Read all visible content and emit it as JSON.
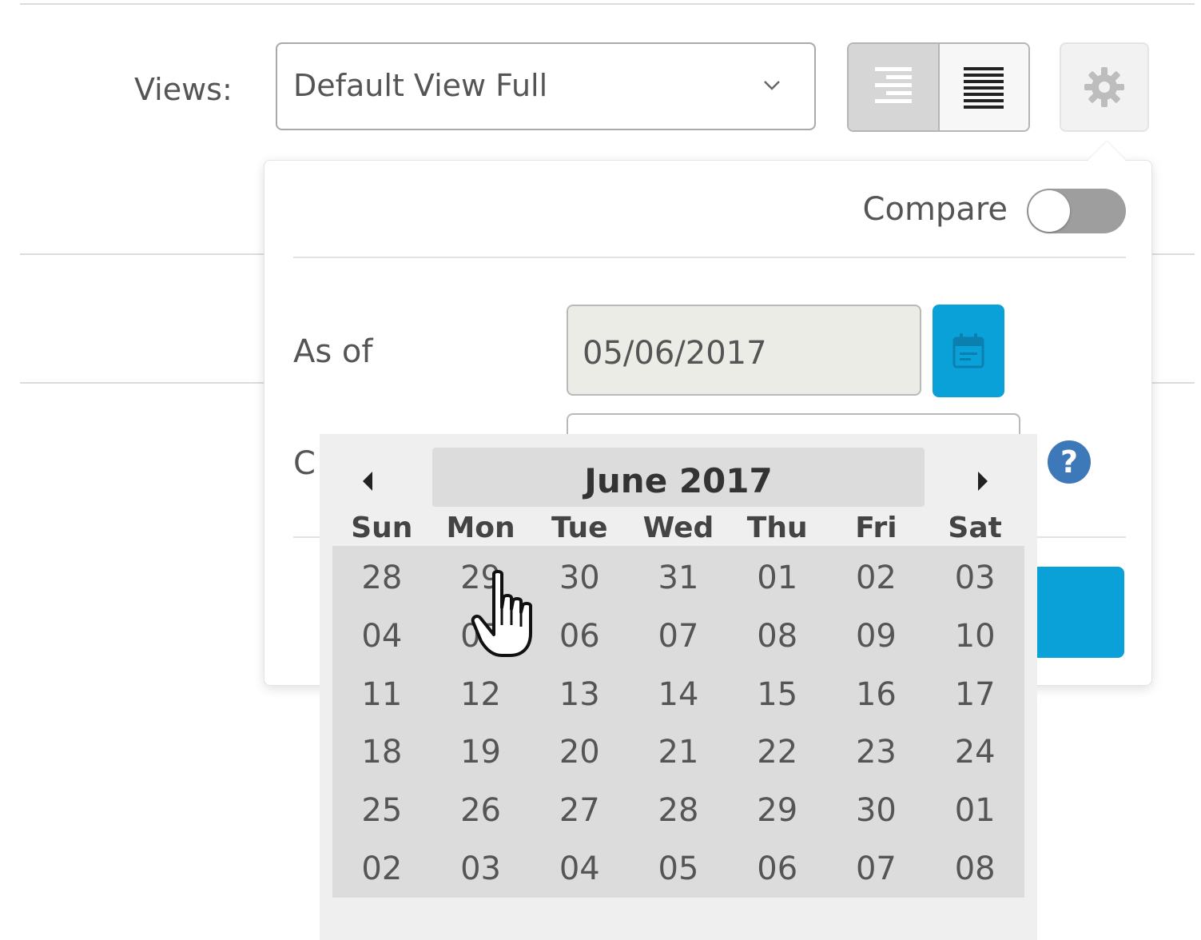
{
  "views": {
    "label": "Views:",
    "selected": "Default View Full"
  },
  "popover": {
    "compare_label": "Compare",
    "compare_enabled": false,
    "as_of_label": "As of",
    "as_of_value": "05/06/2017",
    "row2_label_partial": "C"
  },
  "datepicker": {
    "title": "June 2017",
    "weekdays": [
      "Sun",
      "Mon",
      "Tue",
      "Wed",
      "Thu",
      "Fri",
      "Sat"
    ],
    "days": [
      "28",
      "29",
      "30",
      "31",
      "01",
      "02",
      "03",
      "04",
      "05",
      "06",
      "07",
      "08",
      "09",
      "10",
      "11",
      "12",
      "13",
      "14",
      "15",
      "16",
      "17",
      "18",
      "19",
      "20",
      "21",
      "22",
      "23",
      "24",
      "25",
      "26",
      "27",
      "28",
      "29",
      "30",
      "01",
      "02",
      "03",
      "04",
      "05",
      "06",
      "07",
      "08"
    ]
  },
  "icons": {
    "views_dropdown": "chevron-down-icon",
    "layout_left": "indented-list-icon",
    "layout_right": "justified-list-icon",
    "settings": "gear-icon",
    "calendar": "calendar-icon",
    "help": "question-icon",
    "prev": "caret-left-icon",
    "next": "caret-right-icon",
    "cursor": "hand-pointer-icon"
  },
  "colors": {
    "accent": "#0aa1d8",
    "help": "#3d78b8",
    "toggle_off": "#9e9e9e"
  }
}
